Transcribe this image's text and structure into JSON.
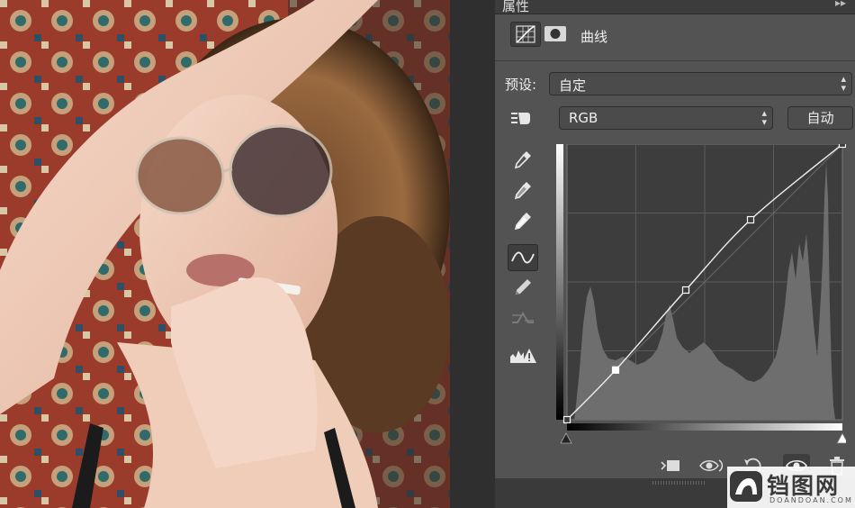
{
  "panel": {
    "title": "属性",
    "collapse_glyph": "▸▸",
    "adjustment_name": "曲线",
    "type_icon": "curves-adjustment-icon",
    "mask_icon": "layer-mask-icon"
  },
  "preset": {
    "label": "预设:",
    "value": "自定"
  },
  "channel": {
    "value": "RGB",
    "auto_label": "自动"
  },
  "tools": [
    {
      "name": "on-image-adjust-icon",
      "active": false
    },
    {
      "name": "black-point-eyedropper-icon",
      "active": false
    },
    {
      "name": "gray-point-eyedropper-icon",
      "active": false
    },
    {
      "name": "white-point-eyedropper-icon",
      "active": false
    },
    {
      "name": "edit-points-curve-icon",
      "active": true
    },
    {
      "name": "pencil-draw-icon",
      "active": false
    },
    {
      "name": "smooth-curve-icon",
      "active": false
    },
    {
      "name": "clipping-warning-icon",
      "active": false
    }
  ],
  "curve": {
    "input_range": [
      0,
      255
    ],
    "output_range": [
      0,
      255
    ],
    "points": [
      [
        0,
        0
      ],
      [
        45,
        46
      ],
      [
        110,
        120
      ],
      [
        170,
        185
      ],
      [
        255,
        255
      ]
    ]
  },
  "bottom_bar": [
    "clip-to-layer-icon",
    "view-previous-state-icon",
    "reset-icon",
    "visibility-icon",
    "delete-icon"
  ],
  "watermark": {
    "text": "铛图网",
    "subtext": "DOANDOAN.COM"
  },
  "colors": {
    "panel_bg": "#535353",
    "graph_bg": "#3d3d3d",
    "histogram": "#6e6e6e",
    "curve": "#f0f0f0"
  }
}
